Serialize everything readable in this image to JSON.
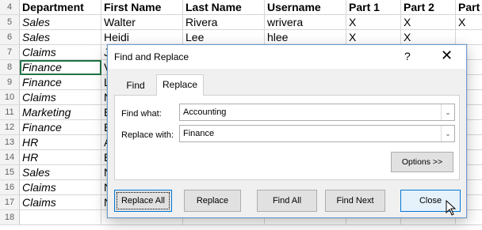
{
  "sheet": {
    "header_row": {
      "num": "4",
      "cells": [
        "Department",
        "First Name",
        "Last Name",
        "Username",
        "Part 1",
        "Part 2",
        "Part"
      ]
    },
    "rows": [
      {
        "num": "5",
        "cells": [
          "Sales",
          "Walter",
          "Rivera",
          "wrivera",
          "X",
          "X",
          "X"
        ]
      },
      {
        "num": "6",
        "cells": [
          "Sales",
          "Heidi",
          "Lee",
          "hlee",
          "X",
          "X",
          ""
        ]
      },
      {
        "num": "7",
        "cells": [
          "Claims",
          "J",
          "",
          "",
          "",
          "",
          ""
        ]
      },
      {
        "num": "8",
        "cells": [
          "Finance",
          "V",
          "",
          "",
          "",
          "",
          ""
        ]
      },
      {
        "num": "9",
        "cells": [
          "Finance",
          "L",
          "",
          "",
          "",
          "",
          ""
        ]
      },
      {
        "num": "10",
        "cells": [
          "Claims",
          "N",
          "",
          "",
          "",
          "",
          ""
        ]
      },
      {
        "num": "11",
        "cells": [
          "Marketing",
          "E",
          "",
          "",
          "",
          "",
          ""
        ]
      },
      {
        "num": "12",
        "cells": [
          "Finance",
          "E",
          "",
          "",
          "",
          "",
          ""
        ]
      },
      {
        "num": "13",
        "cells": [
          "HR",
          "A",
          "",
          "",
          "",
          "",
          ""
        ]
      },
      {
        "num": "14",
        "cells": [
          "HR",
          "E",
          "",
          "",
          "",
          "",
          ""
        ]
      },
      {
        "num": "15",
        "cells": [
          "Sales",
          "N",
          "",
          "",
          "",
          "",
          ""
        ]
      },
      {
        "num": "16",
        "cells": [
          "Claims",
          "N",
          "",
          "",
          "",
          "",
          ""
        ]
      },
      {
        "num": "17",
        "cells": [
          "Claims",
          "N",
          "",
          "",
          "",
          "",
          ""
        ]
      },
      {
        "num": "18",
        "cells": [
          "",
          "",
          "",
          "",
          "",
          "",
          ""
        ]
      }
    ],
    "selected_row": "8"
  },
  "dialog": {
    "title": "Find and Replace",
    "help": "?",
    "close_glyph": "✕",
    "tabs": {
      "find": "Find",
      "replace": "Replace"
    },
    "find_label": "Find what:",
    "find_value": "Accounting",
    "replace_label": "Replace with:",
    "replace_value": "Finance",
    "dropdown_glyph": "⌄",
    "buttons": {
      "options": "Options >>",
      "replace_all": "Replace All",
      "replace": "Replace",
      "find_all": "Find All",
      "find_next": "Find Next",
      "close": "Close"
    }
  },
  "colors": {
    "selection": "#217346",
    "focus": "#0078d7"
  }
}
